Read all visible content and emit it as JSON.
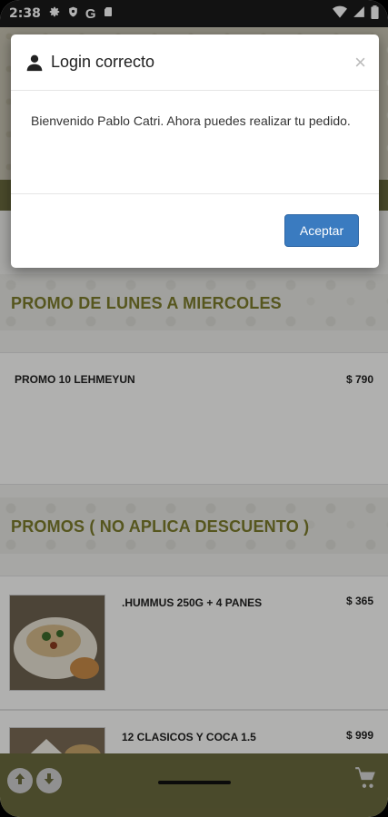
{
  "status_bar": {
    "time": "2:38",
    "left_icons": [
      "gear-icon",
      "shield-icon",
      "google-g-icon",
      "sd-card-icon"
    ],
    "right_icons": [
      "wifi-icon",
      "signal-icon",
      "battery-icon"
    ],
    "g_glyph": "G"
  },
  "modal": {
    "title": "Login correcto",
    "close_label": "×",
    "message": "Bienvenido Pablo Catri. Ahora puedes realizar tu pedido.",
    "accept_label": "Aceptar"
  },
  "sections": [
    {
      "title": "PROMO DE LUNES A MIERCOLES",
      "items": [
        {
          "name": "PROMO 10 LEHMEYUN",
          "price": "$ 790"
        }
      ]
    },
    {
      "title": "PROMOS ( NO APLICA DESCUENTO )",
      "items": [
        {
          "name": ".HUMMUS 250G + 4 PANES",
          "price": "$ 365"
        },
        {
          "name": "12 CLASICOS Y COCA 1.5",
          "price": "$ 999"
        }
      ]
    }
  ],
  "colors": {
    "accent_olive": "#6b6a3e",
    "section_title": "#7c7c2c",
    "button_blue": "#3a7bc0"
  }
}
